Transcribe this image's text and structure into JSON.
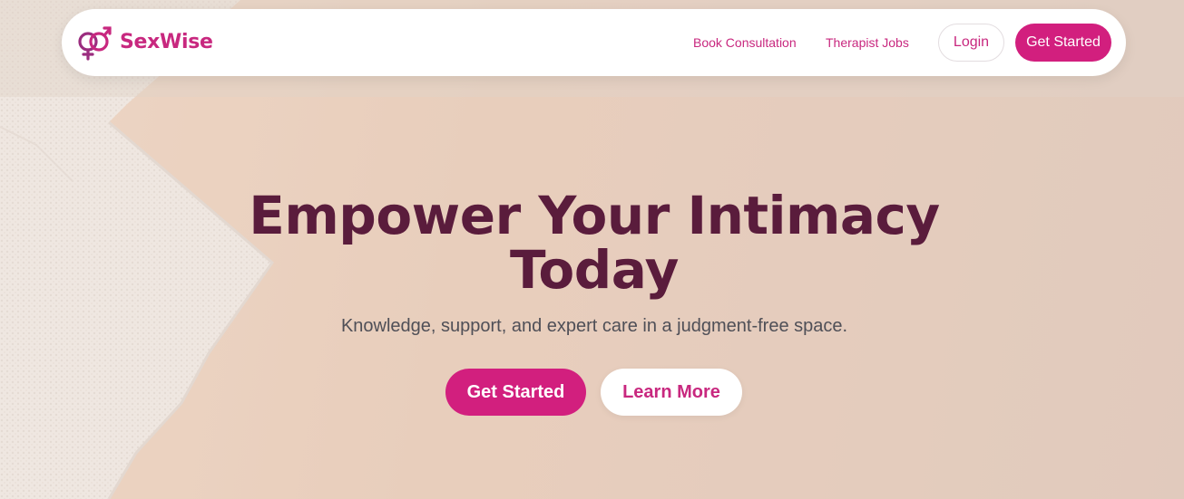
{
  "colors": {
    "brand": "#c8287f",
    "primary_button": "#d21f7e",
    "headline": "#5a1c3c",
    "subtitle": "#4f4f57"
  },
  "header": {
    "logo_icon": "gender-symbols-icon",
    "brand_name": "SexWise",
    "nav": {
      "book_consultation": "Book Consultation",
      "therapist_jobs": "Therapist Jobs",
      "login": "Login",
      "get_started": "Get Started"
    }
  },
  "hero": {
    "headline_line1": "Empower Your Intimacy",
    "headline_line2": "Today",
    "subtitle": "Knowledge, support, and expert care in a judgment-free space.",
    "primary_cta": "Get Started",
    "secondary_cta": "Learn More"
  }
}
